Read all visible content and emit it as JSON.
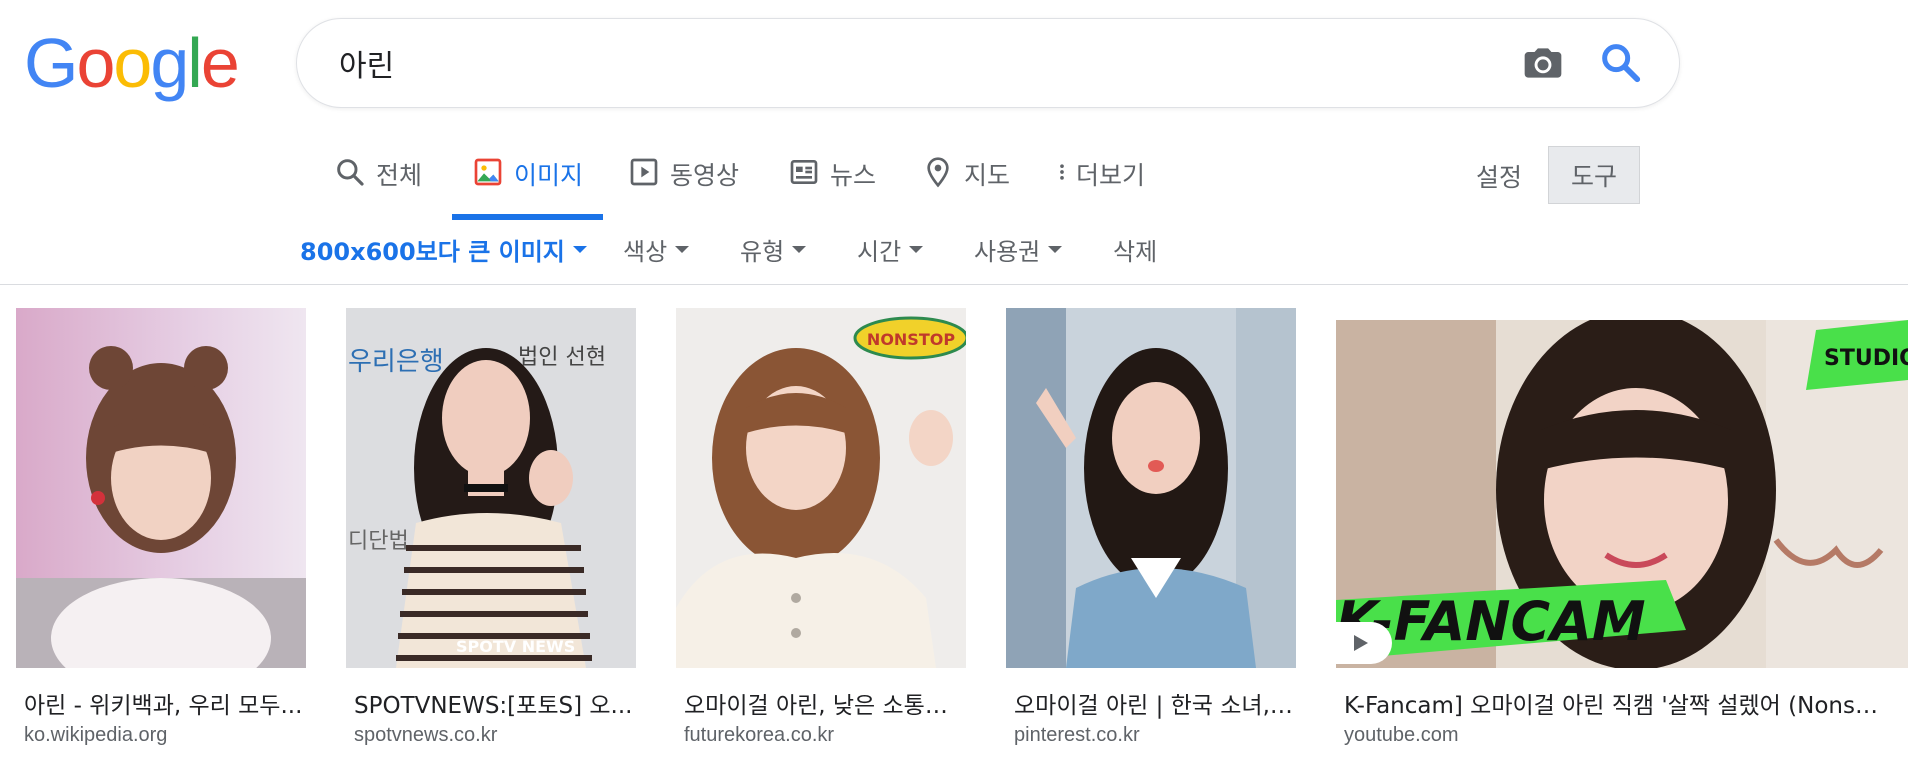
{
  "logo": {
    "letters": [
      "G",
      "o",
      "o",
      "g",
      "l",
      "e"
    ],
    "colors": [
      "#4285F4",
      "#EA4335",
      "#FBBC05",
      "#4285F4",
      "#34A853",
      "#EA4335"
    ]
  },
  "search": {
    "query": "아린",
    "camera_icon": "camera-icon",
    "search_icon": "search-icon"
  },
  "tabs": [
    {
      "label": "전체",
      "icon": "search-icon"
    },
    {
      "label": "이미지",
      "icon": "image-icon",
      "active": true
    },
    {
      "label": "동영상",
      "icon": "play-icon"
    },
    {
      "label": "뉴스",
      "icon": "news-icon"
    },
    {
      "label": "지도",
      "icon": "map-pin-icon"
    },
    {
      "label": "더보기",
      "icon": "more-vert-icon"
    }
  ],
  "settings_label": "설정",
  "tools_label": "도구",
  "filters": [
    {
      "label": "800x600보다 큰 이미지",
      "active": true
    },
    {
      "label": "색상"
    },
    {
      "label": "유형"
    },
    {
      "label": "시간"
    },
    {
      "label": "사용권"
    },
    {
      "label": "삭제"
    }
  ],
  "results": [
    {
      "title": "아린 - 위키백과, 우리 모두...",
      "source": "ko.wikipedia.org"
    },
    {
      "title": "SPOTVNEWS:[포토S] 오...",
      "source": "spotvnews.co.kr"
    },
    {
      "title": "오마이걸 아린, 낮은 소통지...",
      "source": "futurekorea.co.kr"
    },
    {
      "title": "오마이걸 아린 | 한국 소녀, ...",
      "source": "pinterest.co.kr"
    },
    {
      "title": "K-Fancam] 오마이걸 아린 직캠 '살짝 설렜어 (Nonst...",
      "source": "youtube.com"
    }
  ],
  "image_texts": {
    "img2_watermark": "SPOTV NEWS",
    "img2_sign1": "우리은행",
    "img2_sign2": "법인 선현",
    "img2_sign3": "디단법",
    "img3_sticker": "NONSTOP",
    "img5_banner": "K-FANCAM",
    "img5_logo": "STUDIO"
  }
}
